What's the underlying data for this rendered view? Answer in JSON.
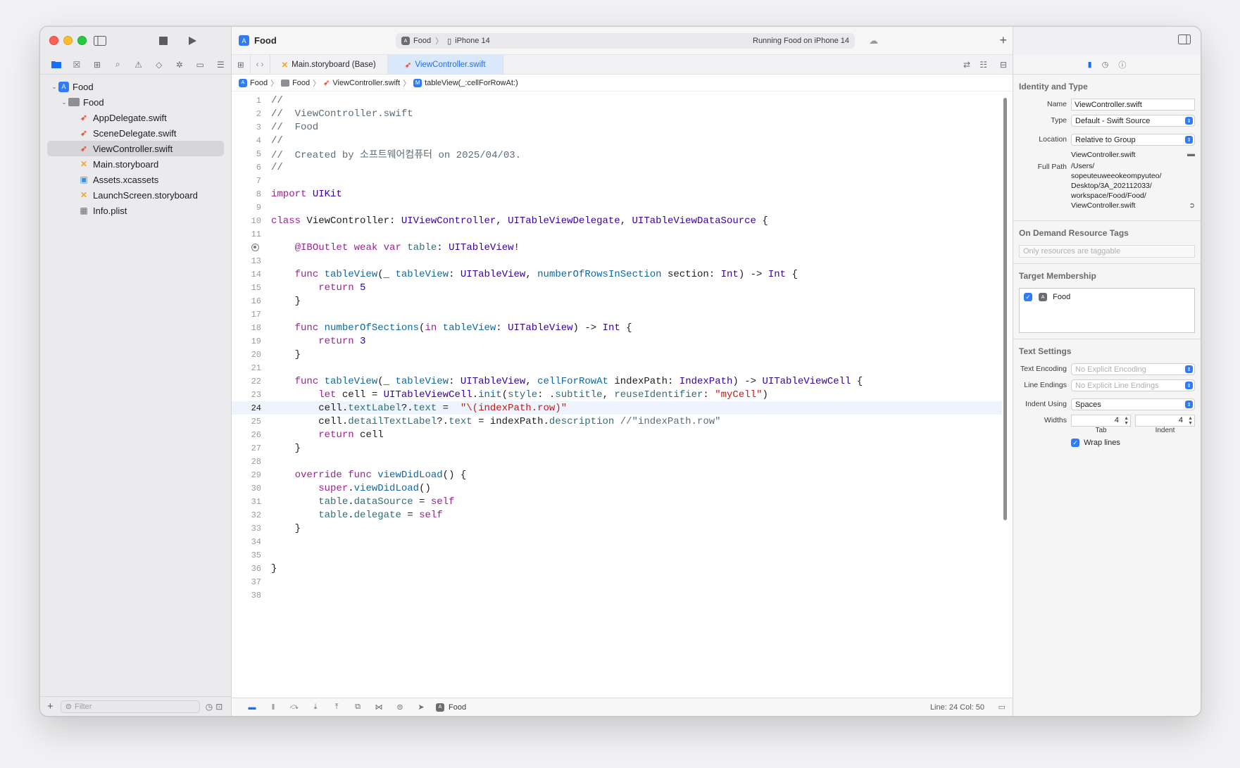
{
  "navigator": {
    "filter_placeholder": "Filter",
    "tree": [
      {
        "label": "Food",
        "type": "project",
        "indent": 0,
        "expanded": true
      },
      {
        "label": "Food",
        "type": "folder",
        "indent": 1,
        "expanded": true
      },
      {
        "label": "AppDelegate.swift",
        "type": "swift",
        "indent": 2
      },
      {
        "label": "SceneDelegate.swift",
        "type": "swift",
        "indent": 2
      },
      {
        "label": "ViewController.swift",
        "type": "swift",
        "indent": 2,
        "selected": true
      },
      {
        "label": "Main.storyboard",
        "type": "storyboard",
        "indent": 2
      },
      {
        "label": "Assets.xcassets",
        "type": "assets",
        "indent": 2
      },
      {
        "label": "LaunchScreen.storyboard",
        "type": "storyboard",
        "indent": 2
      },
      {
        "label": "Info.plist",
        "type": "plist",
        "indent": 2
      }
    ]
  },
  "toolbar": {
    "app_title": "Food",
    "scheme": "Food",
    "device": "iPhone 14",
    "status": "Running Food on iPhone 14"
  },
  "tabs": [
    {
      "label": "Main.storyboard (Base)",
      "active": false
    },
    {
      "label": "ViewController.swift",
      "active": true
    }
  ],
  "breadcrumbs": [
    "Food",
    "Food",
    "ViewController.swift",
    "tableView(_:cellForRowAt:)"
  ],
  "editor": {
    "current_line": 24,
    "lines": [
      "//",
      "//  ViewController.swift",
      "//  Food",
      "//",
      "//  Created by 소프트웨어컴퓨터 on 2025/04/03.",
      "//",
      "",
      "import UIKit",
      "",
      "class ViewController: UIViewController, UITableViewDelegate, UITableViewDataSource {",
      "",
      "    @IBOutlet weak var table: UITableView!",
      "",
      "    func tableView(_ tableView: UITableView, numberOfRowsInSection section: Int) -> Int {",
      "        return 5",
      "    }",
      "",
      "    func numberOfSections(in tableView: UITableView) -> Int {",
      "        return 3",
      "    }",
      "",
      "    func tableView(_ tableView: UITableView, cellForRowAt indexPath: IndexPath) -> UITableViewCell {",
      "        let cell = UITableViewCell.init(style: .subtitle, reuseIdentifier: \"myCell\")",
      "        cell.textLabel?.text =  \"\\(indexPath.row)\"",
      "        cell.detailTextLabel?.text = indexPath.description //\"indexPath.row\"",
      "        return cell",
      "    }",
      "",
      "    override func viewDidLoad() {",
      "        super.viewDidLoad()",
      "        table.dataSource = self",
      "        table.delegate = self",
      "    }",
      "",
      "",
      "}",
      "",
      ""
    ]
  },
  "debug_bar": {
    "target": "Food",
    "line_col": "Line: 24  Col: 50"
  },
  "inspector": {
    "identity_title": "Identity and Type",
    "name_label": "Name",
    "name_value": "ViewController.swift",
    "type_label": "Type",
    "type_value": "Default - Swift Source",
    "location_label": "Location",
    "location_value": "Relative to Group",
    "location_file": "ViewController.swift",
    "fullpath_label": "Full Path",
    "fullpath_lines": [
      "/Users/",
      "sopeuteuweeokeompyuteo/",
      "Desktop/3A_202112033/",
      "workspace/Food/Food/",
      "ViewController.swift"
    ],
    "odr_title": "On Demand Resource Tags",
    "odr_placeholder": "Only resources are taggable",
    "target_title": "Target Membership",
    "target_item": "Food",
    "text_title": "Text Settings",
    "encoding_label": "Text Encoding",
    "encoding_value": "No Explicit Encoding",
    "endings_label": "Line Endings",
    "endings_value": "No Explicit Line Endings",
    "indent_label": "Indent Using",
    "indent_value": "Spaces",
    "widths_label": "Widths",
    "tab_value": "4",
    "indent_width_value": "4",
    "tab_label": "Tab",
    "indent_sub_label": "Indent",
    "wrap_label": "Wrap lines"
  }
}
